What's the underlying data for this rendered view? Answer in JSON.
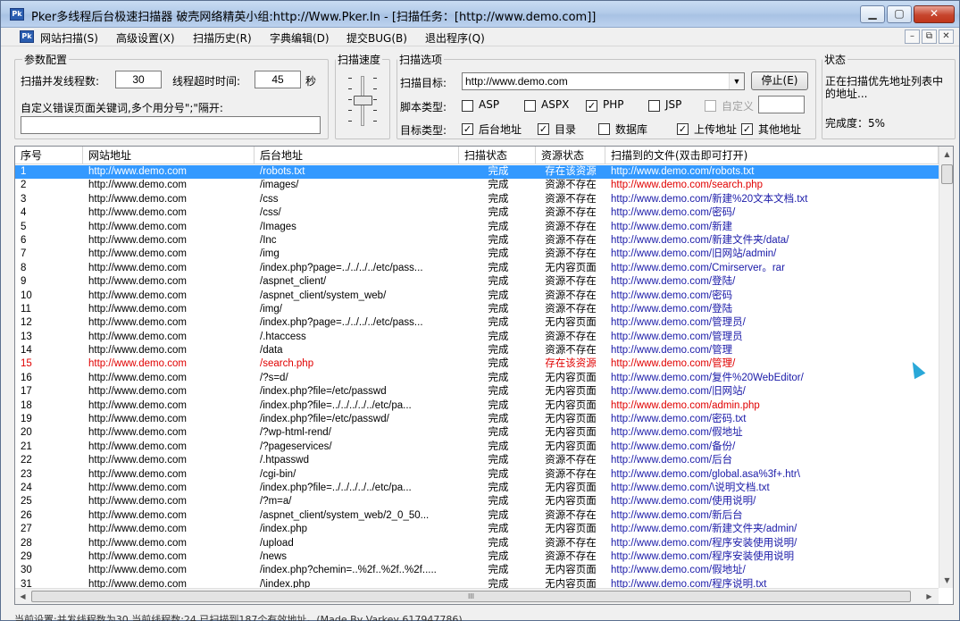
{
  "window": {
    "title": "Pker多线程后台极速扫描器   破壳网络精英小组:http://Www.Pker.In  - [扫描任务：[http://www.demo.com]]",
    "min_label": "▁",
    "max_label": "▢",
    "close_label": "✕"
  },
  "menu": {
    "items": [
      "网站扫描(S)",
      "高级设置(X)",
      "扫描历史(R)",
      "字典编辑(D)",
      "提交BUG(B)",
      "退出程序(Q)"
    ],
    "mdi_min": "–",
    "mdi_restore": "⧉",
    "mdi_close": "✕"
  },
  "params": {
    "title": "参数配置",
    "threads_label": "扫描并发线程数:",
    "threads_value": "30",
    "timeout_label": "线程超时时间:",
    "timeout_value": "45",
    "timeout_unit": "秒",
    "custom_error_label": "自定义错误页面关键词,多个用分号\";\"隔开:",
    "custom_error_value": ""
  },
  "speed": {
    "title": "扫描速度",
    "level": 0.45
  },
  "options": {
    "title": "扫描选项",
    "target_label": "扫描目标:",
    "target_value": "http://www.demo.com",
    "stop_label": "停止(E)",
    "script_label": "脚本类型:",
    "scripts": [
      {
        "label": "ASP",
        "checked": false,
        "disabled": false
      },
      {
        "label": "ASPX",
        "checked": false,
        "disabled": false
      },
      {
        "label": "PHP",
        "checked": true,
        "disabled": false
      },
      {
        "label": "JSP",
        "checked": false,
        "disabled": false
      },
      {
        "label": "自定义",
        "checked": false,
        "disabled": true
      }
    ],
    "custom_value": "",
    "target_type_label": "目标类型:",
    "types": [
      {
        "label": "后台地址",
        "checked": true
      },
      {
        "label": "目录",
        "checked": true
      },
      {
        "label": "数据库",
        "checked": false
      },
      {
        "label": "上传地址",
        "checked": true
      },
      {
        "label": "其他地址",
        "checked": true
      }
    ]
  },
  "status": {
    "title": "状态",
    "message": "正在扫描优先地址列表中的地址...",
    "progress_label": "完成度：5%"
  },
  "table": {
    "columns": [
      "序号",
      "网站地址",
      "后台地址",
      "扫描状态",
      "资源状态",
      "扫描到的文件(双击即可打开)"
    ],
    "rows": [
      [
        "1",
        "http://www.demo.com",
        "/robots.txt",
        "完成",
        "存在该资源",
        "http://www.demo.com/robots.txt"
      ],
      [
        "2",
        "http://www.demo.com",
        "/images/",
        "完成",
        "资源不存在",
        "http://www.demo.com/search.php"
      ],
      [
        "3",
        "http://www.demo.com",
        "/css",
        "完成",
        "资源不存在",
        "http://www.demo.com/新建%20文本文档.txt"
      ],
      [
        "4",
        "http://www.demo.com",
        "/css/",
        "完成",
        "资源不存在",
        "http://www.demo.com/密码/"
      ],
      [
        "5",
        "http://www.demo.com",
        "/Images",
        "完成",
        "资源不存在",
        "http://www.demo.com/新建"
      ],
      [
        "6",
        "http://www.demo.com",
        "/Inc",
        "完成",
        "资源不存在",
        "http://www.demo.com/新建文件夹/data/"
      ],
      [
        "7",
        "http://www.demo.com",
        "/img",
        "完成",
        "资源不存在",
        "http://www.demo.com/旧网站/admin/"
      ],
      [
        "8",
        "http://www.demo.com",
        "/index.php?page=../../../../etc/pass...",
        "完成",
        "无内容页面",
        "http://www.demo.com/Cmirserver。rar"
      ],
      [
        "9",
        "http://www.demo.com",
        "/aspnet_client/",
        "完成",
        "资源不存在",
        "http://www.demo.com/登陆/"
      ],
      [
        "10",
        "http://www.demo.com",
        "/aspnet_client/system_web/",
        "完成",
        "资源不存在",
        "http://www.demo.com/密码"
      ],
      [
        "11",
        "http://www.demo.com",
        "/img/",
        "完成",
        "资源不存在",
        "http://www.demo.com/登陆"
      ],
      [
        "12",
        "http://www.demo.com",
        "/index.php?page=../../../../etc/pass...",
        "完成",
        "无内容页面",
        "http://www.demo.com/管理员/"
      ],
      [
        "13",
        "http://www.demo.com",
        "/.htaccess",
        "完成",
        "资源不存在",
        "http://www.demo.com/管理员"
      ],
      [
        "14",
        "http://www.demo.com",
        "/data",
        "完成",
        "资源不存在",
        "http://www.demo.com/管理"
      ],
      [
        "15",
        "http://www.demo.com",
        "/search.php",
        "完成",
        "存在该资源",
        "http://www.demo.com/管理/"
      ],
      [
        "16",
        "http://www.demo.com",
        "/?s=d/",
        "完成",
        "无内容页面",
        "http://www.demo.com/复件%20WebEditor/"
      ],
      [
        "17",
        "http://www.demo.com",
        "/index.php?file=/etc/passwd",
        "完成",
        "无内容页面",
        "http://www.demo.com/旧网站/"
      ],
      [
        "18",
        "http://www.demo.com",
        "/index.php?file=../../../../../etc/pa...",
        "完成",
        "无内容页面",
        "http://www.demo.com/admin.php"
      ],
      [
        "19",
        "http://www.demo.com",
        "/index.php?file=/etc/passwd/",
        "完成",
        "无内容页面",
        "http://www.demo.com/密码.txt"
      ],
      [
        "20",
        "http://www.demo.com",
        "/?wp-html-rend/",
        "完成",
        "无内容页面",
        "http://www.demo.com/假地址"
      ],
      [
        "21",
        "http://www.demo.com",
        "/?pageservices/",
        "完成",
        "无内容页面",
        "http://www.demo.com/备份/"
      ],
      [
        "22",
        "http://www.demo.com",
        "/.htpasswd",
        "完成",
        "资源不存在",
        "http://www.demo.com/后台"
      ],
      [
        "23",
        "http://www.demo.com",
        "/cgi-bin/",
        "完成",
        "资源不存在",
        "http://www.demo.com/global.asa%3f+.htr\\"
      ],
      [
        "24",
        "http://www.demo.com",
        "/index.php?file=../../../../../etc/pa...",
        "完成",
        "无内容页面",
        "http://www.demo.com/\\说明文档.txt"
      ],
      [
        "25",
        "http://www.demo.com",
        "/?m=a/",
        "完成",
        "无内容页面",
        "http://www.demo.com/使用说明/"
      ],
      [
        "26",
        "http://www.demo.com",
        "/aspnet_client/system_web/2_0_50...",
        "完成",
        "资源不存在",
        "http://www.demo.com/新后台"
      ],
      [
        "27",
        "http://www.demo.com",
        "/index.php",
        "完成",
        "无内容页面",
        "http://www.demo.com/新建文件夹/admin/"
      ],
      [
        "28",
        "http://www.demo.com",
        "/upload",
        "完成",
        "资源不存在",
        "http://www.demo.com/程序安装使用说明/"
      ],
      [
        "29",
        "http://www.demo.com",
        "/news",
        "完成",
        "资源不存在",
        "http://www.demo.com/程序安装使用说明"
      ],
      [
        "30",
        "http://www.demo.com",
        "/index.php?chemin=..%2f..%2f..%2f.....",
        "完成",
        "无内容页面",
        "http://www.demo.com/假地址/"
      ],
      [
        "31",
        "http://www.demo.com",
        "/\\index.php",
        "完成",
        "无内容页面",
        "http://www.demo.com/程序说明.txt"
      ]
    ],
    "selected_row": 0,
    "red_rows": [
      14
    ],
    "red_files": [
      1,
      17
    ],
    "hscroll_grip": "III"
  },
  "statusbar": {
    "text": "当前设置:并发线程数为30,当前线程数:24,已扫描到187个有效地址。(Made By Varkey 617947786)"
  },
  "colors": {
    "selection": "#3399ff",
    "found": "#e00000",
    "file_link": "#1a1aa8"
  }
}
